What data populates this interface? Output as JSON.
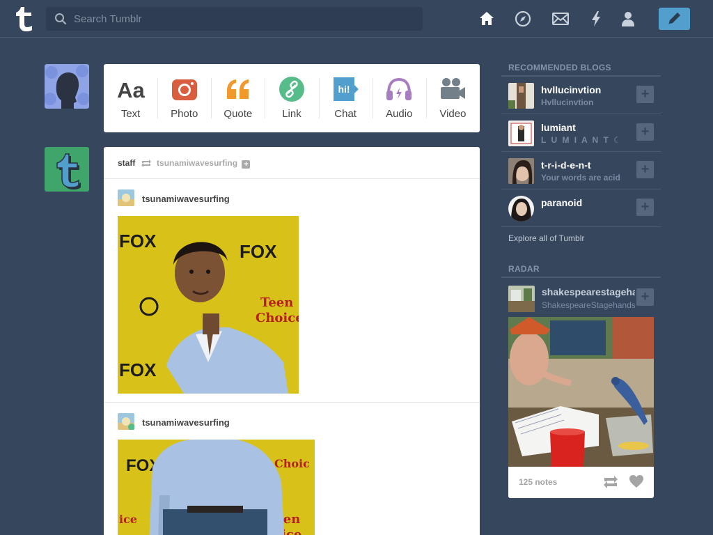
{
  "search": {
    "placeholder": "Search Tumblr"
  },
  "nav": {
    "icons": [
      "home-icon",
      "compass-icon",
      "mail-icon",
      "lightning-icon",
      "account-icon"
    ],
    "compose_icon": "pencil-icon"
  },
  "post_types": [
    {
      "label": "Text",
      "icon": "text-icon",
      "color": "#444444"
    },
    {
      "label": "Photo",
      "icon": "camera-icon",
      "color": "#d95e40"
    },
    {
      "label": "Quote",
      "icon": "quote-icon",
      "color": "#f2992e"
    },
    {
      "label": "Link",
      "icon": "link-icon",
      "color": "#56bc8a"
    },
    {
      "label": "Chat",
      "icon": "chat-icon",
      "color": "#529ecc",
      "icon_text": "hi!"
    },
    {
      "label": "Audio",
      "icon": "headphones-icon",
      "color": "#a77dc2"
    },
    {
      "label": "Video",
      "icon": "video-camera-icon",
      "color": "#748089"
    }
  ],
  "post": {
    "author": "staff",
    "reblogged_from": "tsunamiwavesurfing",
    "entries": [
      {
        "username": "tsunamiwavesurfing"
      },
      {
        "username": "tsunamiwavesurfing"
      }
    ]
  },
  "sidebar": {
    "recommended_title": "RECOMMENDED BLOGS",
    "blogs": [
      {
        "name": "hvllucinvtion",
        "desc": "Hvllucinvtion"
      },
      {
        "name": "lumiant",
        "desc": "L U M I A N T ☾"
      },
      {
        "name": "t-r-i-d-e-n-t",
        "desc": "Your words are acid"
      },
      {
        "name": "paranoid",
        "desc": ""
      }
    ],
    "explore": "Explore all of Tumblr",
    "radar_title": "RADAR",
    "radar": {
      "name": "shakespearestagehands",
      "desc": "ShakespeareStagehands",
      "notes": "125 notes"
    }
  },
  "colors": {
    "background": "#36465d",
    "accent": "#529ecc",
    "card": "#ffffff"
  }
}
